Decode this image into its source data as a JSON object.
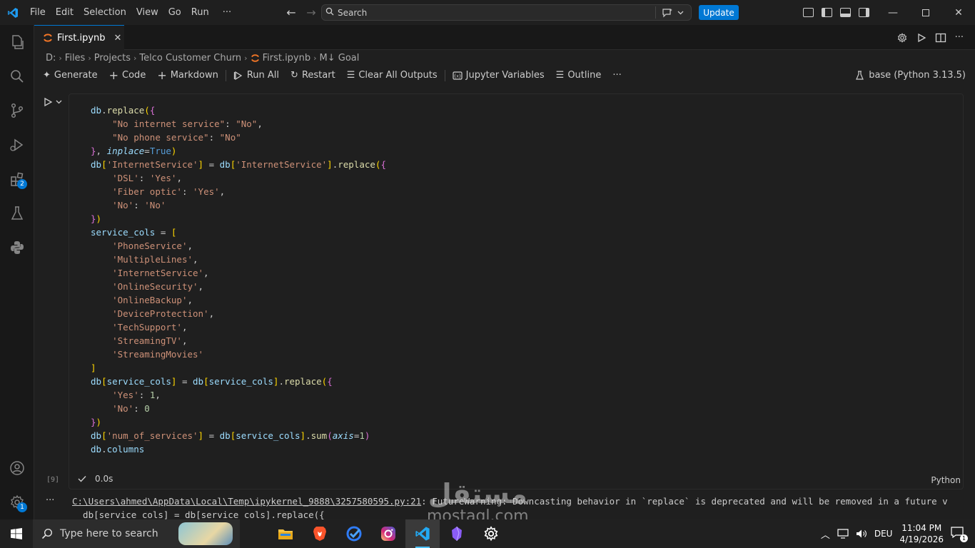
{
  "menu": [
    "File",
    "Edit",
    "Selection",
    "View",
    "Go",
    "Run",
    "···"
  ],
  "search": {
    "placeholder": "Search"
  },
  "update_label": "Update",
  "tab": {
    "label": "First.ipynb",
    "close": "✕"
  },
  "breadcrumb": [
    "D:",
    "Files",
    "Projects",
    "Telco Customer Churn",
    "First.ipynb",
    "M↓ Goal"
  ],
  "toolbar": {
    "generate": "Generate",
    "code": "Code",
    "markdown": "Markdown",
    "run_all": "Run All",
    "restart": "Restart",
    "clear_outputs": "Clear All Outputs",
    "jupyter_variables": "Jupyter Variables",
    "outline": "Outline",
    "more": "···"
  },
  "kernel": "base (Python 3.13.5)",
  "activity_badges": {
    "extensions": "2",
    "settings": "1"
  },
  "cell": {
    "execution_count": "[9]",
    "duration": "0.0s",
    "language": "Python"
  },
  "output": {
    "line1_path": "C:\\Users\\ahmed\\AppData\\Local\\Temp\\ipykernel_9888\\3257580595.py:21",
    "line1_msg": ": FutureWarning: Downcasting behavior in `replace` is deprecated and will be removed in a future v",
    "line2": "  db[service_cols] = db[service_cols].replace({"
  },
  "taskbar": {
    "search_placeholder": "Type here to search",
    "language": "DEU",
    "time": "11:04 PM",
    "date": "4/19/2026",
    "notifications": "1"
  },
  "watermark": {
    "arabic": "مستقل",
    "latin": "mostaql.com"
  },
  "colors": {
    "accent": "#0078d4",
    "background": "#1f1f1f",
    "activitybar": "#181818",
    "taskbar": "#202020"
  }
}
